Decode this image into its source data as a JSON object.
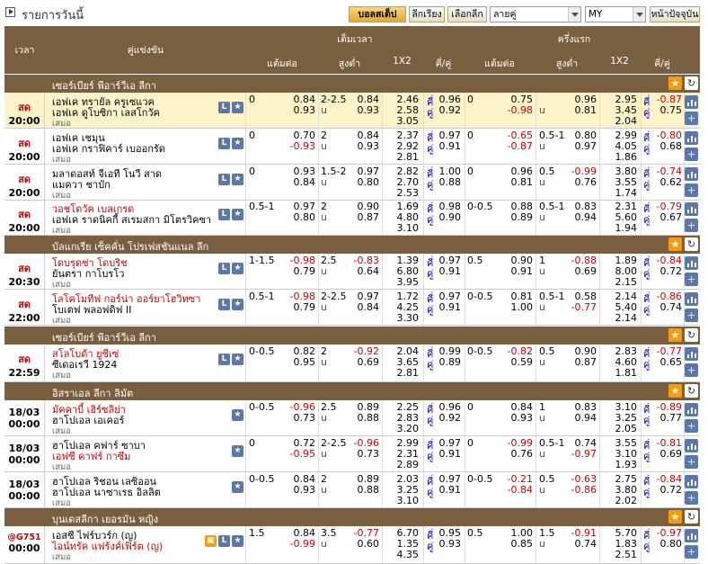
{
  "toolbar": {
    "title": "รายการวันนี้",
    "btn_ball": "บอลสเต็ป",
    "btn_league": "ลีกเรียง",
    "btn_choose": "เลือกลีก",
    "sel_odds": "ลายคู่",
    "sel_region": "MY",
    "btn_now": "หน้าปัจจุบัน"
  },
  "header": {
    "time": "เวลา",
    "match": "คู่แข่งขัน",
    "fulltime": "เต็มเวลา",
    "firsthalf": "ครึ่งแรก",
    "hdp": "แต้มต่อ",
    "ou": "สูงต่ำ",
    "x12": "1X2",
    "oe": "คี่/คู่",
    "hdp2": "แต้มต่อ",
    "ou2": "สูงต่ำ",
    "x122": "1X2",
    "oe2": "คี่/คู่"
  },
  "labels": {
    "draw": "เสมอ",
    "u": "u",
    "ku": "คี่",
    "khu": "คู่",
    "live": "สด"
  },
  "leagues": [
    {
      "name": "เซอร์เบียร์ พีอาร์วีเอ ลีกา"
    },
    {
      "name": "บัลแกเรีย เซ็คคั่น โปรเฟสชันแนล ลีก"
    },
    {
      "name": "เซอร์เบียร์ พีอาร์วีเอ ลีกา"
    },
    {
      "name": "อิสราเอล ลีกา ลิมัต"
    },
    {
      "name": "บุนเดสลีกา เยอรมัน หญิง"
    }
  ],
  "rows": [
    {
      "status": "สด",
      "time": "20:00",
      "home": "เอฟเค ทรายัล ครูเซแวค",
      "away": "เอฟเค ดูโบซิกา เลสโกวัค",
      "hdp": "0",
      "h1": "0.84",
      "h2": "0.93",
      "ou": "2-2.5",
      "o1": "0.84",
      "o2": "0.93",
      "x1": "2.46",
      "x2": "2.58",
      "x3": "3.05",
      "e1": "0.96",
      "e2": "0.92",
      "fhdp": "0",
      "f1": "0.75",
      "f2": "-0.98",
      "fou": "",
      "fo1": "0.96",
      "fo2": "0.81",
      "fx1": "2.95",
      "fx2": "3.45",
      "fx3": "2.04",
      "fe1": "-0.87",
      "fe2": "0.75"
    },
    {
      "status": "สด",
      "time": "20:00",
      "home": "เอฟเค เชมุน",
      "away": "เอฟเค กราฟิคาร์ เบออกรัด",
      "hdp": "0",
      "h1": "0.70",
      "h2": "-0.93",
      "ou": "2",
      "o1": "0.84",
      "o2": "0.93",
      "x1": "2.37",
      "x2": "2.92",
      "x3": "2.81",
      "e1": "0.97",
      "e2": "0.91",
      "fhdp": "0",
      "f1": "-0.65",
      "f2": "-0.87",
      "fou": "0.5-1",
      "fo1": "0.80",
      "fo2": "0.97",
      "fx1": "2.99",
      "fx2": "4.05",
      "fx3": "1.86",
      "fe1": "-0.80",
      "fe2": "0.68"
    },
    {
      "status": "สด",
      "time": "20:00",
      "home": "มลาดอสท์ จีเอที โนวี สาด",
      "away": "แมควา ชาบัก",
      "hdp": "0",
      "h1": "0.93",
      "h2": "0.84",
      "ou": "1.5-2",
      "o1": "0.97",
      "o2": "0.80",
      "x1": "2.82",
      "x2": "2.70",
      "x3": "2.53",
      "e1": "1.00",
      "e2": "0.88",
      "fhdp": "0",
      "f1": "0.96",
      "f2": "0.81",
      "fou": "0.5",
      "fo1": "-0.99",
      "fo2": "0.76",
      "fx1": "3.80",
      "fx2": "3.55",
      "fx3": "1.74",
      "fe1": "-0.74",
      "fe2": "0.62"
    },
    {
      "status": "สด",
      "time": "20:00",
      "home": "วอชโดวัค เบลเกรด",
      "away": "เอฟเค ราดนิคกี้ สเรมสกา มิโตรวิคซา",
      "hdp": "0.5-1",
      "h1": "0.97",
      "h2": "0.80",
      "ou": "2",
      "o1": "0.90",
      "o2": "0.87",
      "x1": "1.69",
      "x2": "4.80",
      "x3": "3.10",
      "e1": "0.98",
      "e2": "0.90",
      "fhdp": "0-0.5",
      "f1": "0.88",
      "f2": "0.89",
      "fou": "0.5-1",
      "fo1": "0.83",
      "fo2": "0.94",
      "fx1": "2.31",
      "fx2": "5.60",
      "fx3": "1.94",
      "fe1": "-0.79",
      "fe2": "0.67"
    },
    {
      "status": "สด",
      "time": "20:30",
      "home": "โดบรุดซ่า โดบริช",
      "away": "ยันตรา กาโบรโว",
      "hdp": "1-1.5",
      "h1": "-0.98",
      "h2": "0.79",
      "ou": "2.5",
      "o1": "-0.83",
      "o2": "0.64",
      "x1": "1.39",
      "x2": "6.80",
      "x3": "3.95",
      "e1": "0.97",
      "e2": "0.91",
      "fhdp": "0.5",
      "f1": "0.90",
      "f2": "0.91",
      "fou": "1",
      "fo1": "-0.88",
      "fo2": "0.69",
      "fx1": "1.89",
      "fx2": "8.00",
      "fx3": "2.15",
      "fe1": "-0.84",
      "fe2": "0.72"
    },
    {
      "status": "สด",
      "time": "22:00",
      "home": "โลโคโมทีฟ กอร์น่า ออร์ยาโฮวิทซา",
      "away": "โบเตฟ พลอฟดิฟ II",
      "hdp": "0.5-1",
      "h1": "-0.98",
      "h2": "0.79",
      "ou": "2-2.5",
      "o1": "0.97",
      "o2": "0.84",
      "x1": "1.72",
      "x2": "4.25",
      "x3": "3.30",
      "e1": "0.97",
      "e2": "0.91",
      "fhdp": "0-0.5",
      "f1": "0.81",
      "f2": "1.00",
      "fou": "0.5-1",
      "fo1": "0.58",
      "fo2": "-0.77",
      "fx1": "2.14",
      "fx2": "5.40",
      "fx3": "2.14",
      "fe1": "-0.86",
      "fe2": "0.74"
    },
    {
      "status": "สด",
      "time": "22:59",
      "home": "สโลโบด้า ยูชีเซ่",
      "away": "ซีเดอเรวี 1924",
      "hdp": "0-0.5",
      "h1": "0.82",
      "h2": "0.95",
      "ou": "2",
      "o1": "-0.92",
      "o2": "0.69",
      "x1": "2.04",
      "x2": "3.65",
      "x3": "2.81",
      "e1": "0.99",
      "e2": "0.89",
      "fhdp": "0-0.5",
      "f1": "-0.82",
      "f2": "0.59",
      "fou": "0.5",
      "fo1": "0.90",
      "fo2": "0.87",
      "fx1": "2.83",
      "fx2": "4.60",
      "fx3": "1.81",
      "fe1": "-0.77",
      "fe2": "0.65"
    },
    {
      "status": "18/03",
      "time": "00:00",
      "home": "มัคคาบี้ เฮิร์ซลิย่า",
      "away": "ฮาโปเอล เอเคอร์",
      "hdp": "0-0.5",
      "h1": "-0.96",
      "h2": "0.73",
      "ou": "2.5",
      "o1": "0.89",
      "o2": "0.88",
      "x1": "2.25",
      "x2": "2.83",
      "x3": "3.20",
      "e1": "0.96",
      "e2": "0.92",
      "fhdp": "0",
      "f1": "0.84",
      "f2": "0.93",
      "fou": "1",
      "fo1": "0.83",
      "fo2": "0.94",
      "fx1": "3.10",
      "fx2": "3.25",
      "fx3": "2.05",
      "fe1": "-0.89",
      "fe2": "0.77"
    },
    {
      "status": "18/03",
      "time": "00:00",
      "home": "ฮาโปเอล คฟาร์ ซาบา",
      "away": "เอฟซี คาฟร์ กาซึม",
      "hdp": "0",
      "h1": "0.72",
      "h2": "-0.95",
      "ou": "2-2.5",
      "o1": "-0.96",
      "o2": "0.73",
      "x1": "2.99",
      "x2": "2.31",
      "x3": "2.89",
      "e1": "0.97",
      "e2": "0.91",
      "fhdp": "0",
      "f1": "-0.99",
      "f2": "0.76",
      "fou": "0.5-1",
      "fo1": "0.74",
      "fo2": "-0.97",
      "fx1": "3.55",
      "fx2": "3.10",
      "fx3": "1.93",
      "fe1": "-0.81",
      "fe2": "0.69"
    },
    {
      "status": "18/03",
      "time": "00:00",
      "home": "ฮาโปเอล ริชอน เลซิออน",
      "away": "ฮาโปเอล นาซาเรธ อิลลิต",
      "hdp": "0-0.5",
      "h1": "0.84",
      "h2": "0.93",
      "ou": "2",
      "o1": "0.89",
      "o2": "0.88",
      "x1": "2.03",
      "x2": "3.25",
      "x3": "3.10",
      "e1": "0.97",
      "e2": "0.91",
      "fhdp": "0-0.5",
      "f1": "-0.21",
      "f2": "-0.84",
      "fou": "0.5",
      "fo1": "-0.63",
      "fo2": "-0.86",
      "fx1": "2.75",
      "fx2": "3.80",
      "fx3": "2.02",
      "fe1": "-0.84",
      "fe2": "0.72"
    },
    {
      "status": "@G751",
      "time": "00:00",
      "home": "เอสซี ไฟร์บวร์ก (ญ)",
      "away": "ไอน์ทรัค แฟร้งค์เฟิร์ต (ญ)",
      "hdp": "1.5",
      "h1": "0.84",
      "h2": "-0.99",
      "ou": "3.5",
      "o1": "-0.77",
      "o2": "0.60",
      "x1": "6.70",
      "x2": "1.35",
      "x3": "4.35",
      "e1": "0.95",
      "e2": "0.93",
      "fhdp": "0.5",
      "f1": "1.00",
      "f2": "0.85",
      "fou": "1.5",
      "fo1": "-0.91",
      "fo2": "0.74",
      "fx1": "5.70",
      "fx2": "1.83",
      "fx3": "2.51",
      "fe1": "-0.97",
      "fe2": "0.80"
    }
  ]
}
